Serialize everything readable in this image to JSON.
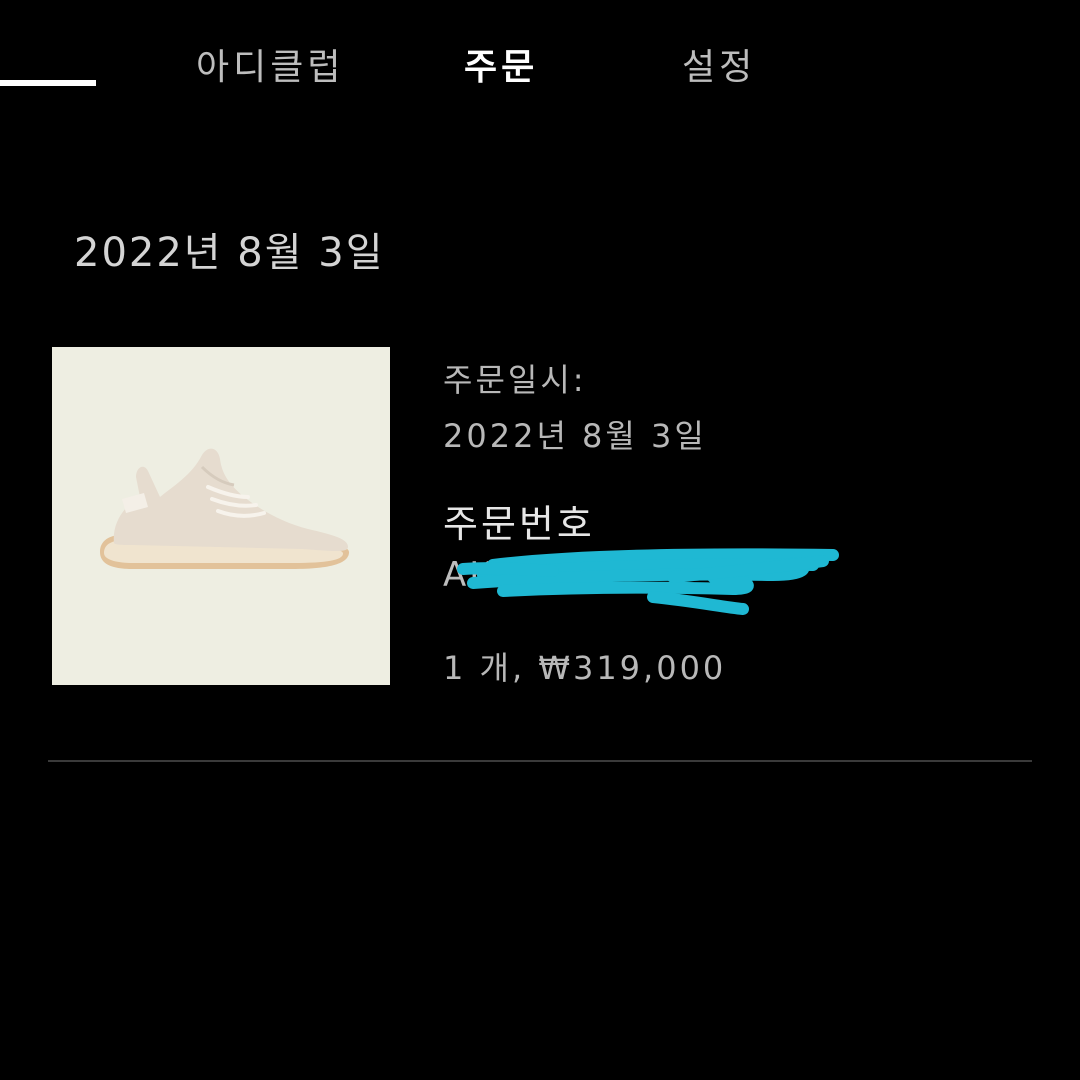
{
  "nav": {
    "tabs": [
      {
        "label": "아디클럽"
      },
      {
        "label": "주문"
      },
      {
        "label": "설정"
      }
    ]
  },
  "order": {
    "date_heading": "2022년 8월 3일",
    "order_date_label": "주문일시:",
    "order_date_value": "2022년 8월 3일",
    "order_number_label": "주문번호",
    "order_number_value": "AKR",
    "quantity_price": "1 개, ₩319,000"
  },
  "colors": {
    "background": "#000000",
    "active_tab": "#ffffff",
    "inactive_tab": "#bdbdbd",
    "redaction": "#1fb8d3",
    "product_bg": "#eeeee2"
  }
}
